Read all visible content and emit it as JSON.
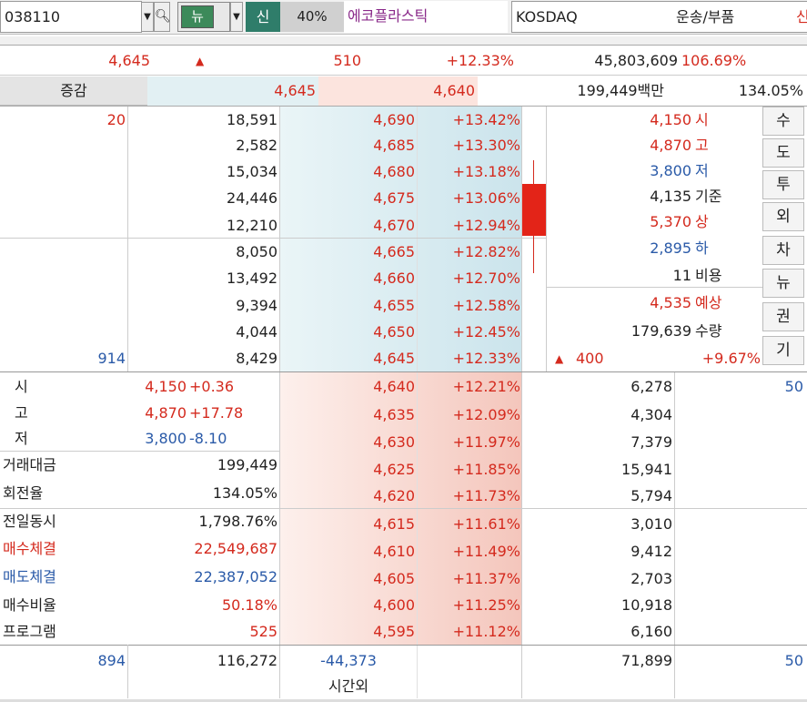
{
  "top": {
    "code": "038110",
    "news_btn": "뉴",
    "new_label": "신",
    "pct": "40%",
    "name": "에코플라스틱",
    "market": "KOSDAQ",
    "sector": "운송/부품",
    "right_cut": "신"
  },
  "summary": {
    "price": "4,645",
    "arrow": "▲",
    "change": "510",
    "rate": "+12.33%",
    "volume": "45,803,609",
    "vol_ratio": "106.69%"
  },
  "row2": {
    "label": "증감",
    "ask": "4,645",
    "bid": "4,640",
    "amount": "199,449백만",
    "turnover": "134.05%"
  },
  "asks": [
    {
      "price": "4,690",
      "rate": "+13.42%",
      "qty": "18,591"
    },
    {
      "price": "4,685",
      "rate": "+13.30%",
      "qty": "2,582"
    },
    {
      "price": "4,680",
      "rate": "+13.18%",
      "qty": "15,034"
    },
    {
      "price": "4,675",
      "rate": "+13.06%",
      "qty": "24,446"
    },
    {
      "price": "4,670",
      "rate": "+12.94%",
      "qty": "12,210"
    },
    {
      "price": "4,665",
      "rate": "+12.82%",
      "qty": "8,050"
    },
    {
      "price": "4,660",
      "rate": "+12.70%",
      "qty": "13,492"
    },
    {
      "price": "4,655",
      "rate": "+12.58%",
      "qty": "9,394"
    },
    {
      "price": "4,650",
      "rate": "+12.45%",
      "qty": "4,044"
    },
    {
      "price": "4,645",
      "rate": "+12.33%",
      "qty": "8,429"
    }
  ],
  "ask_left": {
    "first": "20",
    "last": "914"
  },
  "bids": [
    {
      "price": "4,640",
      "rate": "+12.21%",
      "qty": "6,278"
    },
    {
      "price": "4,635",
      "rate": "+12.09%",
      "qty": "4,304"
    },
    {
      "price": "4,630",
      "rate": "+11.97%",
      "qty": "7,379"
    },
    {
      "price": "4,625",
      "rate": "+11.85%",
      "qty": "15,941"
    },
    {
      "price": "4,620",
      "rate": "+11.73%",
      "qty": "5,794"
    },
    {
      "price": "4,615",
      "rate": "+11.61%",
      "qty": "3,010"
    },
    {
      "price": "4,610",
      "rate": "+11.49%",
      "qty": "9,412"
    },
    {
      "price": "4,605",
      "rate": "+11.37%",
      "qty": "2,703"
    },
    {
      "price": "4,600",
      "rate": "+11.25%",
      "qty": "10,918"
    },
    {
      "price": "4,595",
      "rate": "+11.12%",
      "qty": "6,160"
    }
  ],
  "bid_right": {
    "first": "50"
  },
  "info": [
    {
      "val": "4,150",
      "label": "시"
    },
    {
      "val": "4,870",
      "label": "고"
    },
    {
      "val": "3,800",
      "label": "저"
    },
    {
      "val": "4,135",
      "label": "기준"
    },
    {
      "val": "5,370",
      "label": "상"
    },
    {
      "val": "2,895",
      "label": "하"
    },
    {
      "val": "11",
      "label": "비용"
    },
    {
      "val": "4,535",
      "label": "예상"
    },
    {
      "val": "179,639",
      "label": "수량"
    }
  ],
  "expected": {
    "arrow": "▲",
    "change": "400",
    "rate": "+9.67%"
  },
  "side_buttons": [
    "수",
    "도",
    "투",
    "외",
    "차",
    "뉴",
    "권",
    "기"
  ],
  "ohl": [
    {
      "label": "시",
      "val": "4,150",
      "pct": "+0.36"
    },
    {
      "label": "고",
      "val": "4,870",
      "pct": "+17.78"
    },
    {
      "label": "저",
      "val": "3,800",
      "pct": "-8.10"
    }
  ],
  "stats": [
    {
      "label": "거래대금",
      "val": "199,449"
    },
    {
      "label": "회전율",
      "val": "134.05%"
    },
    {
      "label": "전일동시",
      "val": "1,798.76%"
    },
    {
      "label": "매수체결",
      "val": "22,549,687"
    },
    {
      "label": "매도체결",
      "val": "22,387,052"
    },
    {
      "label": "매수비율",
      "val": "50.18%"
    },
    {
      "label": "프로그램",
      "val": "525"
    }
  ],
  "footer": {
    "left": "894",
    "ask_total": "116,272",
    "net": "-44,373",
    "bid_total": "71,899",
    "right": "50",
    "after_hours": "시간외"
  },
  "colors": {
    "up": "#d42a1e",
    "down": "#2a5aa8",
    "ask_bg": "#d6eaf0",
    "bid_bg": "#f7d4cc"
  }
}
